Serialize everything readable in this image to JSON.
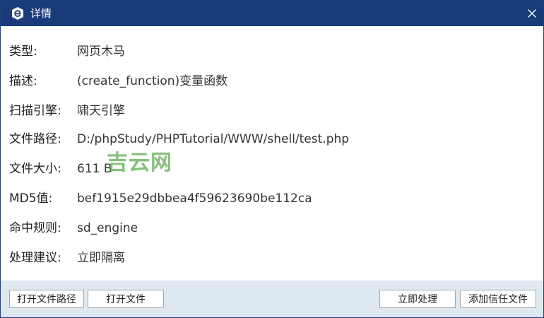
{
  "window": {
    "title": "详情",
    "title_icon": "app-logo-icon",
    "close_icon": "close-icon",
    "title_bar_color": "#1a3b7a"
  },
  "details": [
    {
      "label": "类型:",
      "value": "网页木马"
    },
    {
      "label": "描述:",
      "value": "(create_function)变量函数"
    },
    {
      "label": "扫描引擎:",
      "value": "啸天引擎"
    },
    {
      "label": "文件路径:",
      "value": "D:/phpStudy/PHPTutorial/WWW/shell/test.php"
    },
    {
      "label": "文件大小:",
      "value": "611 B"
    },
    {
      "label": "MD5值:",
      "value": "bef1915e29dbbea4f59623690be112ca"
    },
    {
      "label": "命中规则:",
      "value": "sd_engine"
    },
    {
      "label": "处理建议:",
      "value": "立即隔离"
    }
  ],
  "watermark": "吉云网",
  "buttons": {
    "open_path": "打开文件路径",
    "open_file": "打开文件",
    "handle_now": "立即处理",
    "add_trust": "添加信任文件"
  }
}
